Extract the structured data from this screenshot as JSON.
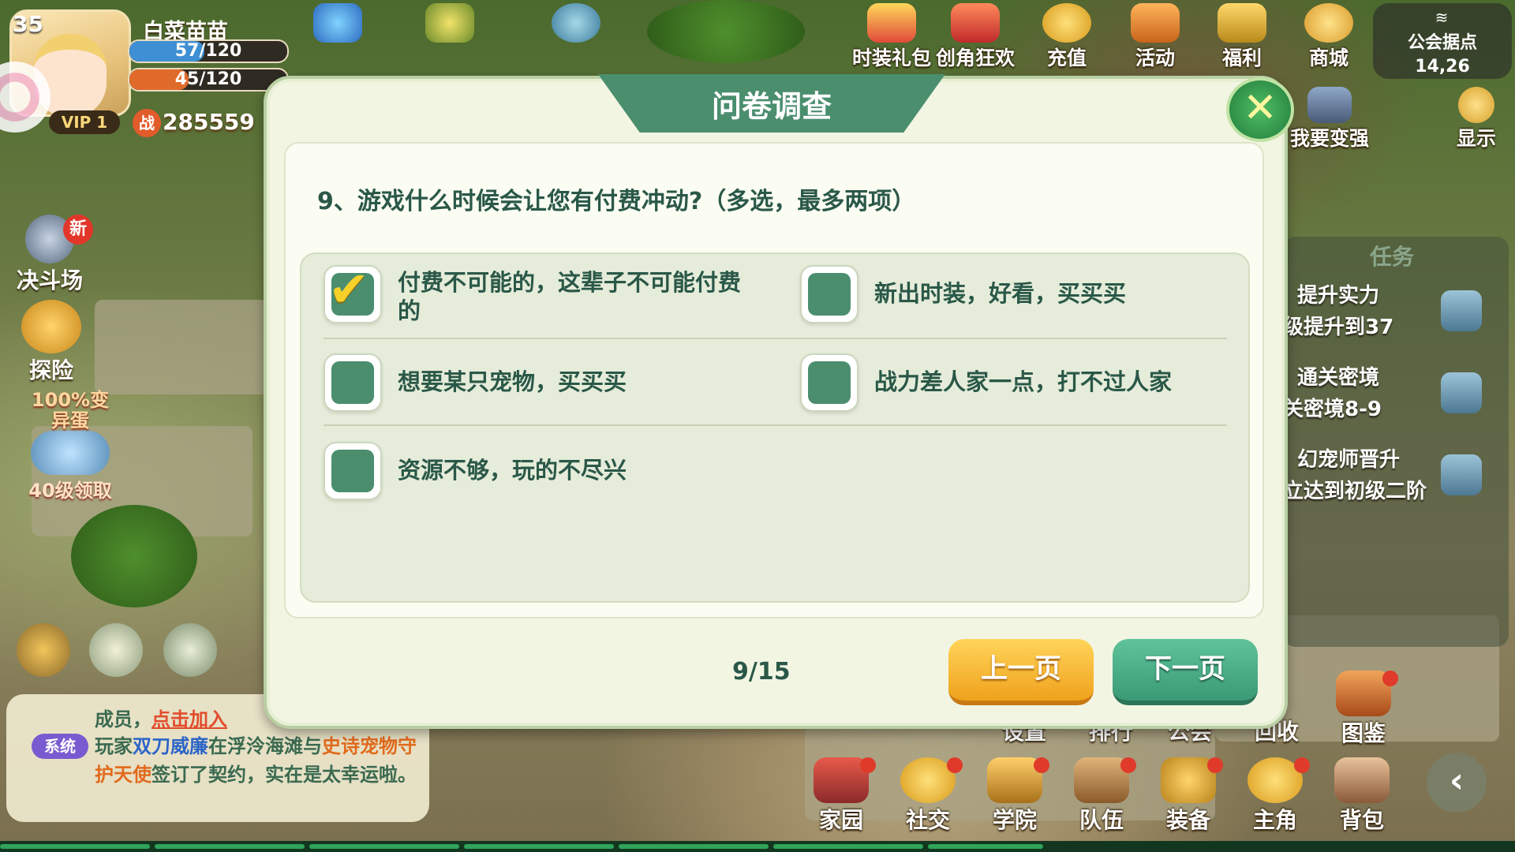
{
  "player": {
    "level": "35",
    "name": "白菜苗苗",
    "hp": "57/120",
    "hp_fraction": 0.475,
    "energy": "45/120",
    "energy_fraction": 0.375,
    "vip": "VIP 1",
    "power_icon": "战",
    "power": "285559"
  },
  "top_menu": {
    "items": [
      {
        "label": "时装礼包",
        "icon": "gift-box-icon"
      },
      {
        "label": "创角狂欢",
        "icon": "celebration-icon"
      },
      {
        "label": "充值",
        "icon": "recharge-icon"
      },
      {
        "label": "活动",
        "icon": "event-icon"
      },
      {
        "label": "福利",
        "icon": "welfare-icon"
      },
      {
        "label": "商城",
        "icon": "shop-icon"
      }
    ],
    "guild_point": "公会据点",
    "coords": "14,26",
    "strengthen": "我要变强",
    "display": "显示"
  },
  "left_icons": {
    "arena": "决斗场",
    "new_badge": "新",
    "explore": "探险",
    "egg_reward": "40级领取",
    "egg_banner": "100%变异蛋"
  },
  "tasks": {
    "title": "任务",
    "items": [
      {
        "title": "提升实力",
        "detail": "级提升到37"
      },
      {
        "title": "通关密境",
        "detail": "关密境8-9"
      },
      {
        "title": "幻宠师晋升",
        "detail": "立达到初级二阶"
      }
    ]
  },
  "chat": {
    "member": "成员，",
    "join": "点击加入",
    "system_tag": "系统",
    "msg_prefix": "玩家",
    "msg_player": "双刀威廉",
    "msg_mid1": "在浮泠海滩与",
    "msg_pet": "史诗宠物守护天使",
    "msg_suffix": "签订了契约，实在是太幸运啦。"
  },
  "bottom_nav": {
    "upper": [
      "设置",
      "排行",
      "公会",
      "回收",
      "图鉴"
    ],
    "lower": [
      "家园",
      "社交",
      "学院",
      "队伍",
      "装备",
      "主角",
      "背包"
    ]
  },
  "survey": {
    "title": "问卷调查",
    "close_icon": "close-icon",
    "question": "9、游戏什么时候会让您有付费冲动?（多选，最多两项）",
    "options": [
      {
        "label": "付费不可能的，这辈子不可能付费的",
        "checked": true
      },
      {
        "label": "新出时装，好看，买买买",
        "checked": false
      },
      {
        "label": "想要某只宠物，买买买",
        "checked": false
      },
      {
        "label": "战力差人家一点，打不过人家",
        "checked": false
      },
      {
        "label": "资源不够，玩的不尽兴",
        "checked": false
      }
    ],
    "page": "9/15",
    "prev_label": "上一页",
    "next_label": "下一页"
  },
  "colors": {
    "primary_green": "#4a8e6e",
    "check_yellow": "#f6d12a",
    "prev_orange": "#f0a21c",
    "text_dark_green": "#2a5848"
  }
}
